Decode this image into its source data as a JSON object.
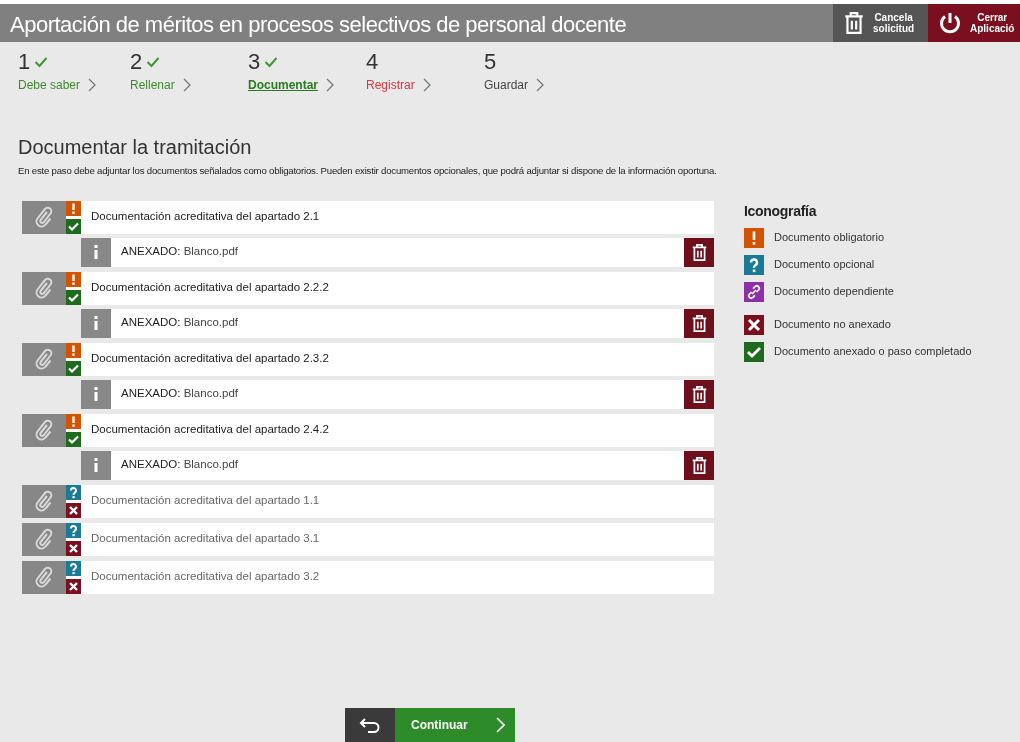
{
  "header": {
    "title": "Aportación de méritos en procesos selectivos de personal docente",
    "buttons": [
      {
        "kind": "cancel",
        "label_lines": [
          "Cancela",
          "solicitud"
        ]
      },
      {
        "kind": "close",
        "label_lines": [
          "Cerrar",
          "Aplicació"
        ]
      }
    ]
  },
  "steps": [
    {
      "number": "1",
      "label": "Debe saber",
      "completed": true,
      "selected": false,
      "error": false
    },
    {
      "number": "2",
      "label": "Rellenar",
      "completed": true,
      "selected": false,
      "error": false
    },
    {
      "number": "3",
      "label": "Documentar",
      "completed": true,
      "selected": true,
      "error": false
    },
    {
      "number": "4",
      "label": "Registrar",
      "completed": false,
      "selected": false,
      "error": true
    },
    {
      "number": "5",
      "label": "Guardar",
      "completed": false,
      "selected": false,
      "error": false
    }
  ],
  "section": {
    "title": "Documentar la tramitación",
    "description": "En este paso debe adjuntar los documentos señalados como obligatorios. Pueden existir documentos opcionales, que podrá adjuntar si dispone de la información oportuna."
  },
  "documents": [
    {
      "title": "Documentación acreditativa del apartado 2.1",
      "kind": "mandatory",
      "attached": true,
      "attachment": "ANEXADO: **Blanco.pdf**"
    },
    {
      "title": "Documentación acreditativa del apartado 2.2.2",
      "kind": "mandatory",
      "attached": true,
      "attachment": "ANEXADO: **Blanco.pdf**"
    },
    {
      "title": "Documentación acreditativa del apartado 2.3.2",
      "kind": "mandatory",
      "attached": true,
      "attachment": "ANEXADO: **Blanco.pdf**"
    },
    {
      "title": "Documentación acreditativa del apartado 2.4.2",
      "kind": "mandatory",
      "attached": true,
      "attachment": "ANEXADO: **Blanco.pdf**"
    },
    {
      "title": "Documentación acreditativa del apartado 1.1",
      "kind": "optional",
      "attached": false
    },
    {
      "title": "Documentación acreditativa del apartado 3.1",
      "kind": "optional",
      "attached": false
    },
    {
      "title": "Documentación acreditativa del apartado 3.2",
      "kind": "optional",
      "attached": false
    }
  ],
  "legend": {
    "title": "Iconografía",
    "items": [
      {
        "kind": "mandatory",
        "label": "Documento obligatorio"
      },
      {
        "kind": "optional",
        "label": "Documento opcional"
      },
      {
        "kind": "dependent",
        "label": "Documento dependiente"
      },
      {
        "kind": "not_attached",
        "label": "Documento no anexado"
      },
      {
        "kind": "attached",
        "label": "Documento anexado o paso completado"
      }
    ]
  },
  "continue_button": {
    "label": "Continuar"
  }
}
